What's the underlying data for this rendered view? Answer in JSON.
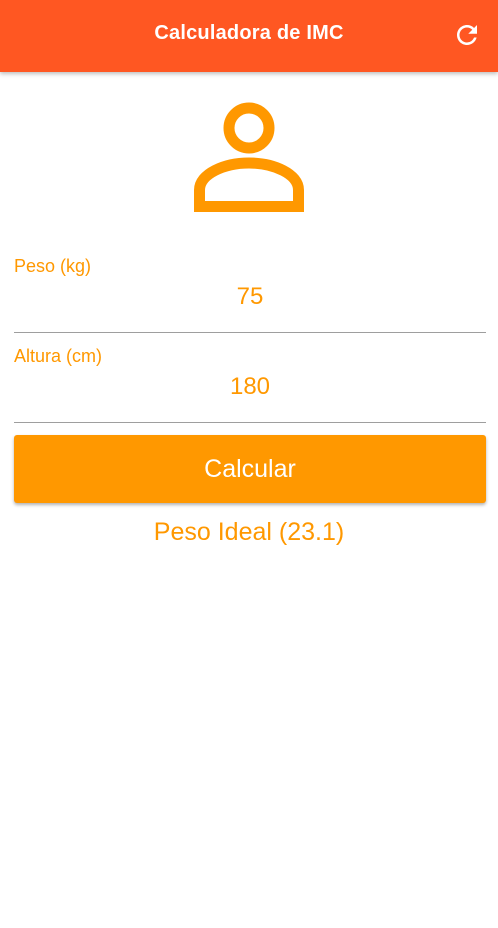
{
  "app_bar": {
    "title": "Calculadora de IMC",
    "refresh_icon": "refresh-icon",
    "background_color": "#FF5722"
  },
  "avatar": {
    "icon": "person-outline-icon",
    "color": "#FF9800"
  },
  "form": {
    "weight": {
      "label": "Peso (kg)",
      "value": "75"
    },
    "height": {
      "label": "Altura (cm)",
      "value": "180"
    }
  },
  "calculate_button": {
    "label": "Calcular",
    "color": "#FF9800"
  },
  "result": {
    "text": "Peso Ideal (23.1)"
  },
  "colors": {
    "accent": "#FF9800",
    "primary": "#FF5722",
    "divider": "#9e9e9e"
  }
}
